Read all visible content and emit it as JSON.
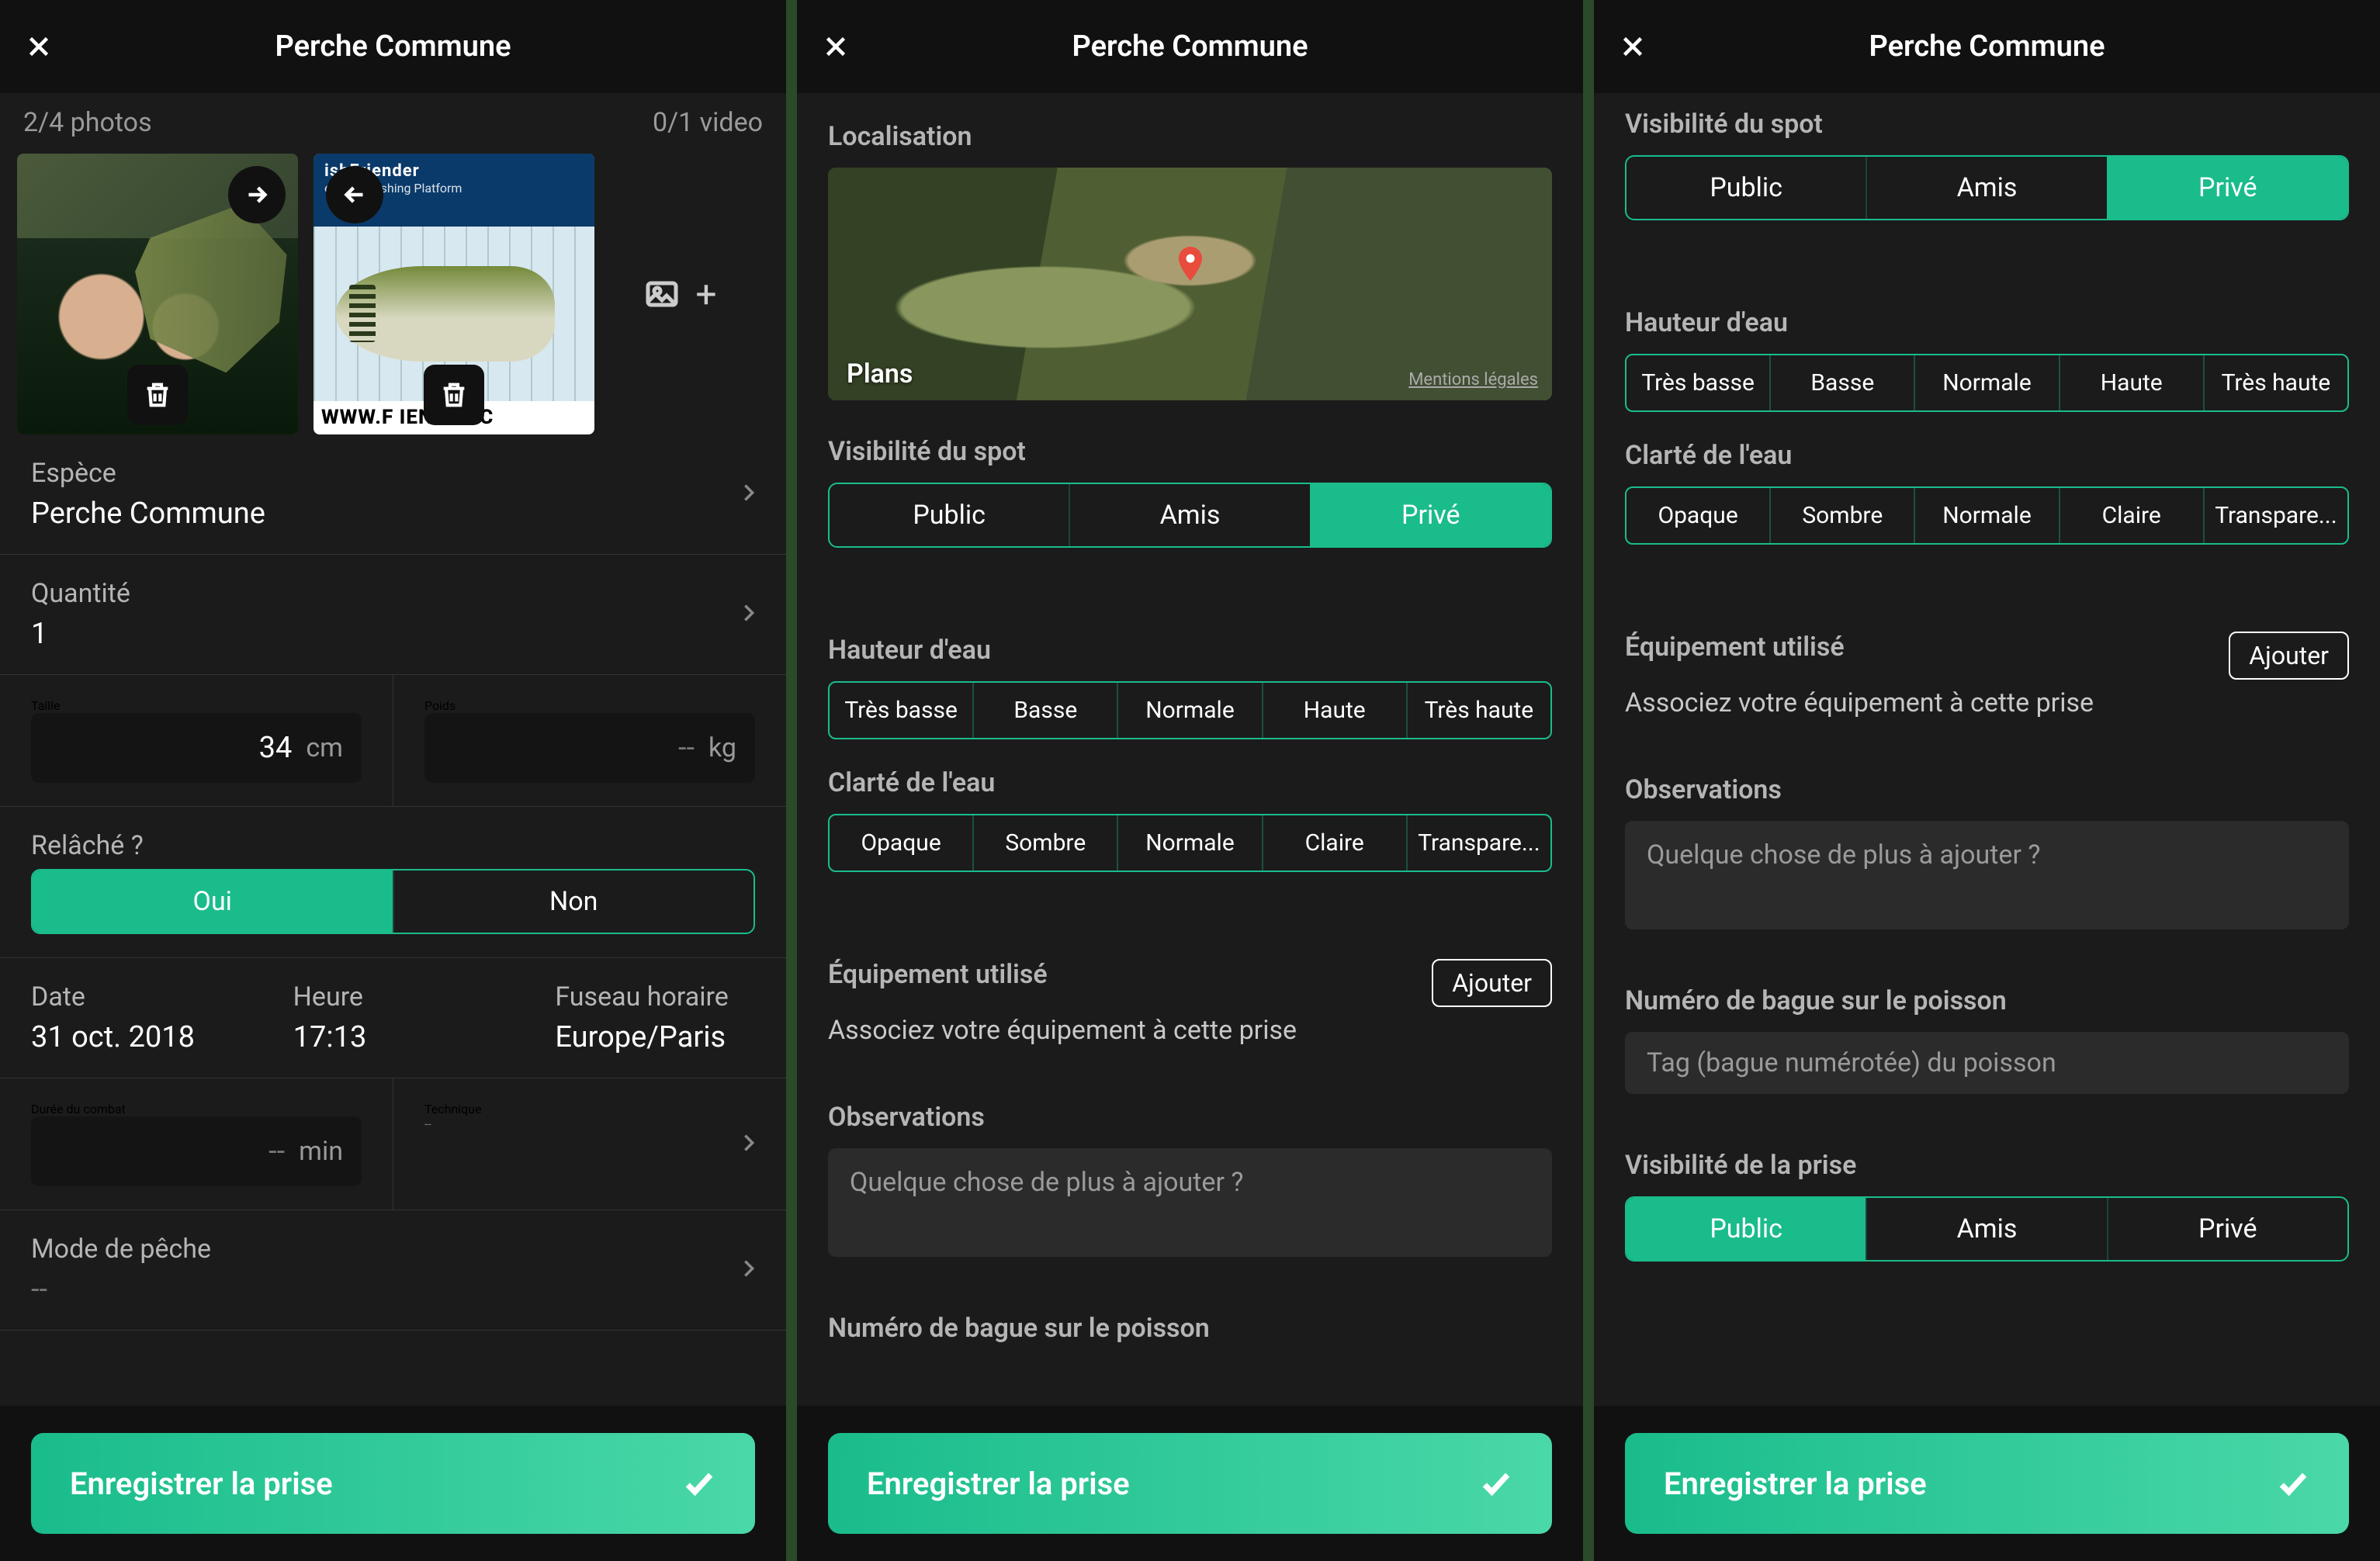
{
  "title": "Perche Commune",
  "save_label": "Enregistrer la prise",
  "screen1": {
    "photo_count": "2/4 photos",
    "video_count": "0/1 video",
    "photo2_banner_logo": "ishFriender",
    "photo2_banner_tag": "e Social Fishing Platform",
    "photo2_url": "WWW.F             IENDER.C",
    "species_label": "Espèce",
    "species_value": "Perche Commune",
    "quantity_label": "Quantité",
    "quantity_value": "1",
    "size_label": "Taille",
    "size_value": "34",
    "size_unit": "cm",
    "weight_label": "Poids",
    "weight_value": "--",
    "weight_unit": "kg",
    "released_label": "Relâché ?",
    "released_yes": "Oui",
    "released_no": "Non",
    "date_label": "Date",
    "date_value": "31 oct. 2018",
    "time_label": "Heure",
    "time_value": "17:13",
    "tz_label": "Fuseau horaire",
    "tz_value": "Europe/Paris",
    "fight_label": "Durée du combat",
    "fight_value": "--",
    "fight_unit": "min",
    "technique_label": "Technique",
    "technique_value": "--",
    "mode_label": "Mode de pêche",
    "mode_value": "--"
  },
  "screen2": {
    "loc_label": "Localisation",
    "map_brand": "Plans",
    "map_legal": "Mentions légales",
    "spot_vis_label": "Visibilité du spot",
    "vis_public": "Public",
    "vis_friends": "Amis",
    "vis_private": "Privé",
    "water_h_label": "Hauteur d'eau",
    "wh": [
      "Très basse",
      "Basse",
      "Normale",
      "Haute",
      "Très haute"
    ],
    "water_c_label": "Clarté de l'eau",
    "wc": [
      "Opaque",
      "Sombre",
      "Normale",
      "Claire",
      "Transpare..."
    ],
    "equip_label": "Équipement utilisé",
    "equip_add": "Ajouter",
    "equip_sub": "Associez votre équipement à cette prise",
    "obs_label": "Observations",
    "obs_placeholder": "Quelque chose de plus à ajouter ?",
    "tag_label": "Numéro de bague sur le poisson"
  },
  "screen3": {
    "spot_vis_label": "Visibilité du spot",
    "vis_public": "Public",
    "vis_friends": "Amis",
    "vis_private": "Privé",
    "water_h_label": "Hauteur d'eau",
    "wh": [
      "Très basse",
      "Basse",
      "Normale",
      "Haute",
      "Très haute"
    ],
    "water_c_label": "Clarté de l'eau",
    "wc": [
      "Opaque",
      "Sombre",
      "Normale",
      "Claire",
      "Transpare..."
    ],
    "equip_label": "Équipement utilisé",
    "equip_add": "Ajouter",
    "equip_sub": "Associez votre équipement à cette prise",
    "obs_label": "Observations",
    "obs_placeholder": "Quelque chose de plus à ajouter ?",
    "tag_label": "Numéro de bague sur le poisson",
    "tag_placeholder": "Tag (bague numérotée) du poisson",
    "catch_vis_label": "Visibilité de la prise"
  }
}
